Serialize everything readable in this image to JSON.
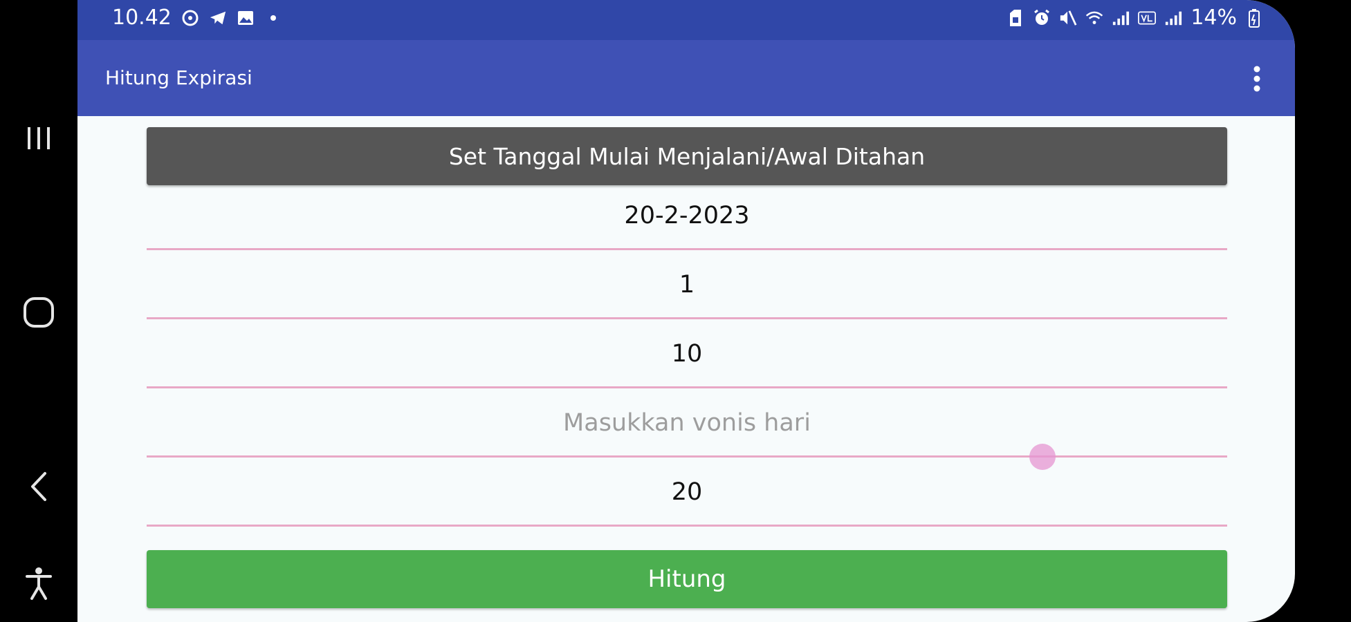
{
  "status_bar": {
    "time": "10.42",
    "battery": "14%",
    "icons_left": [
      "whatsapp-icon",
      "telegram-icon",
      "gallery-icon",
      "dot-icon"
    ],
    "icons_right": [
      "sim-icon",
      "alarm-icon",
      "mute-icon",
      "wifi-icon",
      "signal-icon",
      "volte-icon",
      "signal-icon",
      "battery-icon"
    ]
  },
  "app_bar": {
    "title": "Hitung Expirasi",
    "menu_icon": "more-vertical-icon"
  },
  "form": {
    "set_date_label": "Set Tanggal Mulai Menjalani/Awal Ditahan",
    "date_value": "20-2-2023",
    "field2_value": "1",
    "field3_value": "10",
    "vonis_hari_placeholder": "Masukkan vonis hari",
    "field5_value": "20",
    "hitung_label": "Hitung"
  },
  "nav_bar": {
    "buttons": [
      "recents-icon",
      "home-icon",
      "back-icon",
      "accessibility-icon"
    ]
  },
  "colors": {
    "status_bar": "#3047a8",
    "app_bar": "#3f51b5",
    "primary_button": "#565656",
    "hitung_button": "#4caf50",
    "underline": "#e8a8c6"
  }
}
